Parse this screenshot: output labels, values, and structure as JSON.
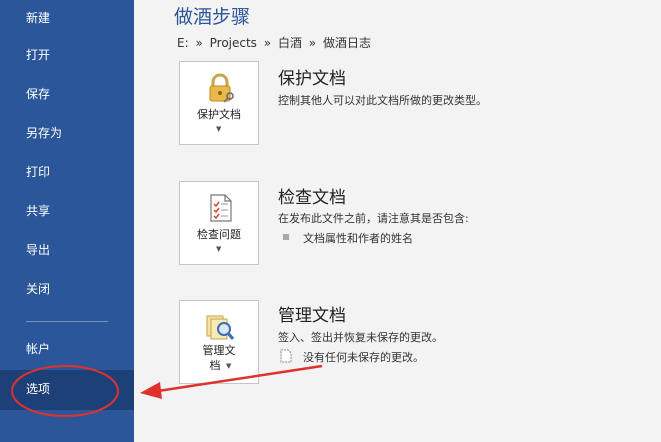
{
  "sidebar": {
    "items": [
      {
        "id": "new",
        "label": "新建"
      },
      {
        "id": "open",
        "label": "打开"
      },
      {
        "id": "save",
        "label": "保存"
      },
      {
        "id": "saveas",
        "label": "另存为"
      },
      {
        "id": "print",
        "label": "打印"
      },
      {
        "id": "share",
        "label": "共享"
      },
      {
        "id": "export",
        "label": "导出"
      },
      {
        "id": "close",
        "label": "关闭"
      }
    ],
    "account": "帐户",
    "options": "选项"
  },
  "main": {
    "title": "做酒步骤",
    "breadcrumb": [
      "E:",
      "»",
      "Projects",
      "»",
      "白酒",
      "»",
      "做酒日志"
    ],
    "protect": {
      "button_label": "保护文档",
      "title": "保护文档",
      "desc": "控制其他人可以对此文档所做的更改类型。"
    },
    "inspect": {
      "button_label": "检查问题",
      "title": "检查文档",
      "desc": "在发布此文件之前，请注意其是否包含:",
      "bullet": "文档属性和作者的姓名"
    },
    "manage": {
      "button_label_line1": "管理文",
      "button_label_line2": "档",
      "title": "管理文档",
      "desc": "签入、签出并恢复未保存的更改。",
      "bullet": "没有任何未保存的更改。"
    }
  },
  "colors": {
    "sidebar": "#2b579a",
    "sidebar_active": "#1e4079",
    "annotation": "#e0322c"
  }
}
